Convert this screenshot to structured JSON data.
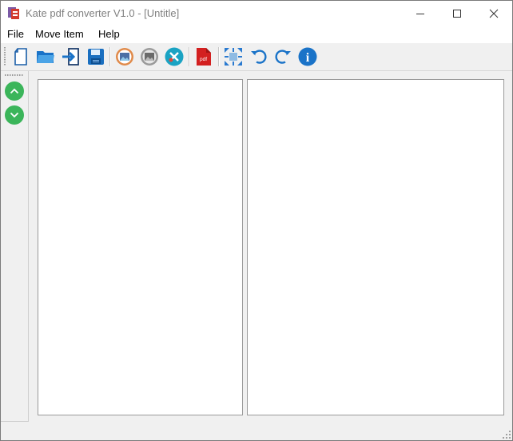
{
  "window": {
    "title": "Kate pdf converter V1.0 - [Untitle]",
    "controls": [
      "minimize-icon",
      "maximize-icon",
      "close-icon"
    ]
  },
  "menu": {
    "file": "File",
    "move_item": "Move Item",
    "help": "Help"
  },
  "toolbar": {
    "icons": [
      "new-document-icon",
      "open-folder-icon",
      "import-icon",
      "save-icon",
      "image-icon",
      "image-gray-icon",
      "tools-icon",
      "pdf-icon",
      "fit-page-icon",
      "rotate-left-icon",
      "rotate-right-icon",
      "info-icon"
    ],
    "pdf_badge": "pdf",
    "info_glyph": "i"
  },
  "side_toolbar": {
    "icons": [
      "move-up-icon",
      "move-down-icon"
    ]
  },
  "colors": {
    "accent_blue": "#1a73c8",
    "side_green": "#3bb55a",
    "pdf_red": "#d32020",
    "tools_teal": "#1aa3c3",
    "image_orange": "#e08a4a"
  }
}
